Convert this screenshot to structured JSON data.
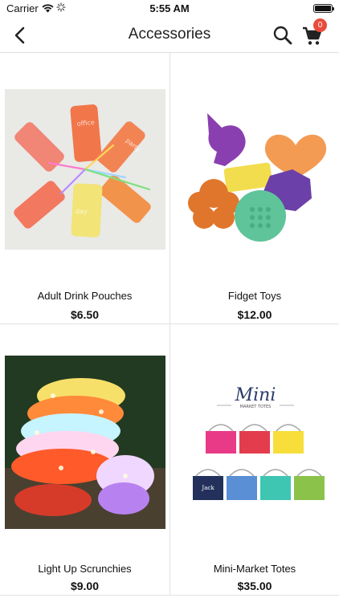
{
  "status_bar": {
    "carrier": "Carrier",
    "time": "5:55 AM"
  },
  "nav": {
    "title": "Accessories",
    "cart_count": "0"
  },
  "products": [
    {
      "name": "Adult Drink Pouches",
      "price": "$6.50",
      "image": "drink-pouches-photo"
    },
    {
      "name": "Fidget Toys",
      "price": "$12.00",
      "image": "fidget-toys-photo"
    },
    {
      "name": "Light Up Scrunchies",
      "price": "$9.00",
      "image": "scrunchies-photo"
    },
    {
      "name": "Mini-Market Totes",
      "price": "$35.00",
      "image": "totes-photo",
      "image_text": {
        "brand": "Mini",
        "subtitle": "MARKET TOTES",
        "tote_names": [
          "Jack"
        ]
      }
    }
  ],
  "colors": {
    "badge": "#e84b3c",
    "divider": "#e2e2e2"
  }
}
